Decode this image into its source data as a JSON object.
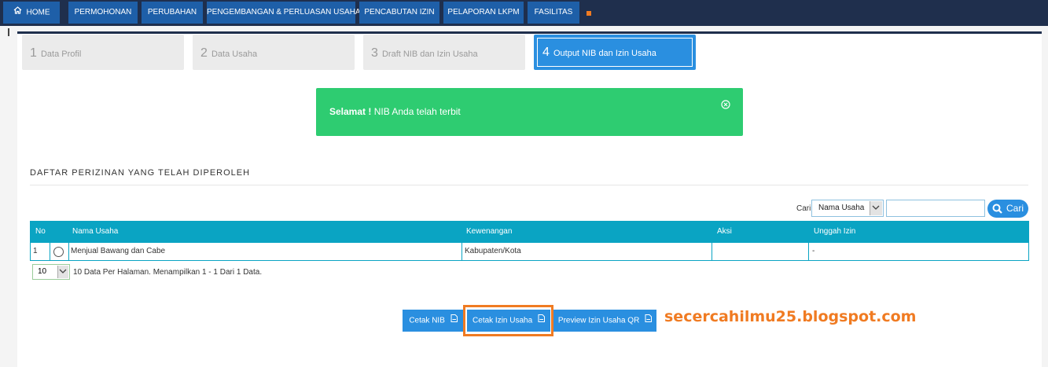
{
  "nav": {
    "items": [
      "HOME",
      "PERMOHONAN",
      "PERUBAHAN",
      "PENGEMBANGAN & PERLUASAN USAHA",
      "PENCABUTAN IZIN",
      "PELAPORAN LKPM",
      "FASILITAS"
    ],
    "accent_color": "#f07b22",
    "bg_color": "#1f2f4d",
    "item_color": "#1e5fa8"
  },
  "steps": [
    {
      "num": "1",
      "label": "Data Profil"
    },
    {
      "num": "2",
      "label": "Data Usaha"
    },
    {
      "num": "3",
      "label": "Draft NIB dan Izin Usaha"
    },
    {
      "num": "4",
      "label": "Output NIB dan Izin Usaha"
    }
  ],
  "alert": {
    "strong": "Selamat !",
    "text": " NIB Anda telah terbit",
    "close_icon": "close-circle-icon",
    "color": "#2ecc71"
  },
  "section": {
    "title": "DAFTAR PERIZINAN YANG TELAH DIPEROLEH"
  },
  "search": {
    "label": "Cari",
    "field_selected": "Nama Usaha",
    "input_value": "",
    "button_label": "Cari"
  },
  "table": {
    "headers": [
      "No",
      "Nama Usaha",
      "Kewenangan",
      "Aksi",
      "Unggah Izin"
    ],
    "rows": [
      {
        "no": "1",
        "nama_usaha": "Menjual Bawang dan Cabe",
        "kewenangan": "Kabupaten/Kota",
        "aksi": "",
        "unggah_izin": "-"
      }
    ],
    "header_color": "#0aa4c3"
  },
  "pagination": {
    "per_page": "10",
    "info": "10 Data Per Halaman. Menampilkan 1 - 1 Dari 1 Data."
  },
  "actions": {
    "cetak_nib": "Cetak NIB",
    "cetak_izin_usaha": "Cetak Izin Usaha",
    "preview_izin_qr": "Preview Izin Usaha QR",
    "color": "#2a8fe0"
  },
  "watermark": "secercahilmu25.blogspot.com"
}
